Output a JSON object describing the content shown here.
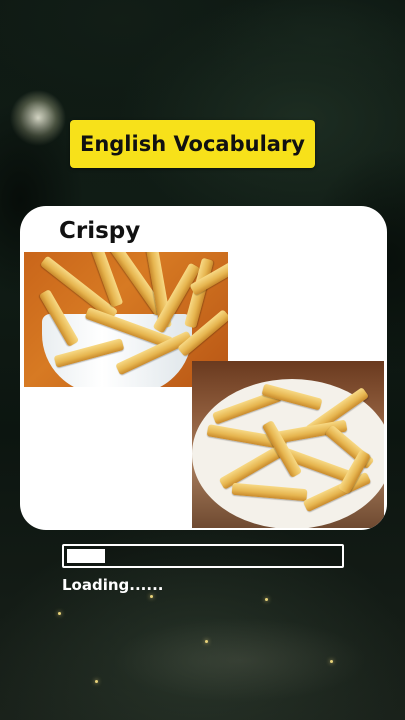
{
  "title_badge": {
    "text": "English Vocabulary",
    "background": "#f7e11a"
  },
  "card": {
    "word": "Crispy",
    "images": [
      {
        "name": "french-fries-in-white-cup"
      },
      {
        "name": "french-fries-on-plate"
      }
    ]
  },
  "progress": {
    "fraction": 0.14,
    "label": "Loading......"
  }
}
